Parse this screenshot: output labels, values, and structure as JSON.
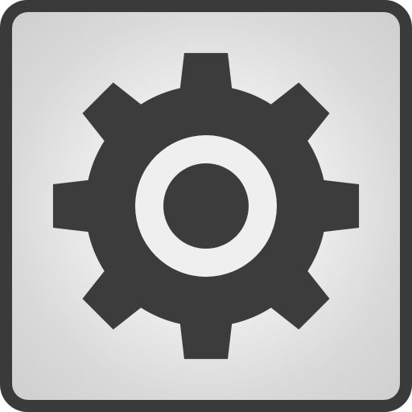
{
  "icon": {
    "name": "gear-icon",
    "colors": {
      "frame": "#3a3a3a",
      "tile_center": "#ffffff",
      "tile_edge": "#cfcfcf",
      "gear": "#3c3c3c",
      "ring": "#efefef"
    }
  }
}
